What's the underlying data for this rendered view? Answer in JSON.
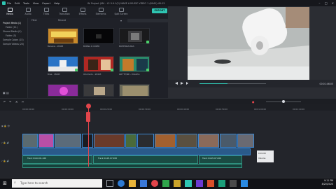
{
  "app": {
    "name": "Filmora9",
    "menu": [
      "File",
      "Edit",
      "Tools",
      "View",
      "Export",
      "Help"
    ],
    "project_title": "W. Project (M4 - L2 0.9.1(2) MAKE A MUSIC VIDEO 1 (6041):45:15"
  },
  "toolbar": {
    "tabs": [
      "Media",
      "Audio",
      "Titles",
      "Transition",
      "Effects",
      "Elements",
      "Split Screen"
    ],
    "export_label": "EXPORT"
  },
  "sidebar": {
    "items": [
      "Project Media (1)",
      "Folder (11)",
      "Shared Media (0)",
      "Folder (0)",
      "Sample Colors (15)",
      "Sample Videos (20)"
    ]
  },
  "browser": {
    "filter_label": "Filter",
    "sort_label": "Record",
    "thumbnails": [
      {
        "label": "Banana - 18463",
        "bg": "#c98a2a"
      },
      {
        "label": "BURNA 4 COKER",
        "bg": "#060608"
      },
      {
        "label": "BOHEMIAN BAS",
        "bg": "#1a1a1c"
      },
      {
        "label": "Blue - 18463",
        "bg": "#2a74c6"
      },
      {
        "label": "Odumodu - 18463",
        "bg": "#b02823"
      },
      {
        "label": "GRY'TE/ND - Imbatho",
        "bg": "#2a8a6a"
      },
      {
        "label": "",
        "bg": "#8a2b9a"
      },
      {
        "label": "",
        "bg": "#3a3a3c"
      },
      {
        "label": "",
        "bg": "#6b6a5a"
      }
    ]
  },
  "preview": {
    "time": "00:01:46:05",
    "zoom": "Full"
  },
  "timeline": {
    "ruler": [
      "00:00:00:00",
      "00:00:10:00",
      "00:00:20:00",
      "00:00:30:00",
      "00:00:40:00",
      "00:00:50:00",
      "00:01:00:00",
      "00:01:10:00",
      "00:01:20:00"
    ],
    "audio_clip_1": "Track 04.02.01.169",
    "audio_clip_2": "Track 04.05.07.008",
    "audio_clip_3": "Track 04.05.07.009",
    "tooltip": {
      "line1": "0:01:00",
      "line2": "Volume"
    }
  },
  "taskbar": {
    "search_placeholder": "Type here to search",
    "time": "9:11 PM",
    "date": "8/20/2020"
  }
}
